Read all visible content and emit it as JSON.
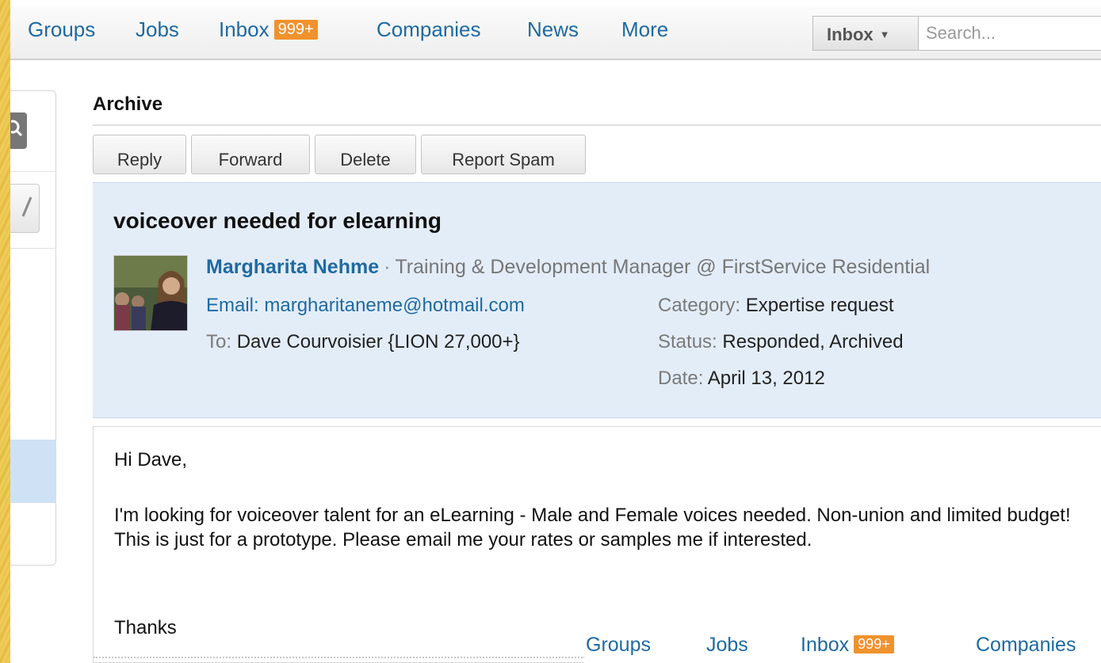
{
  "topnav": {
    "items": [
      "Groups",
      "Jobs",
      "Inbox",
      "Companies",
      "News",
      "More"
    ],
    "inbox_badge": "999+",
    "search_scope": "Inbox",
    "search_placeholder": "Search..."
  },
  "archive": {
    "title": "Archive",
    "buttons": [
      "Reply",
      "Forward",
      "Delete",
      "Report Spam"
    ]
  },
  "message": {
    "subject": "voiceover needed for elearning",
    "sender_name": "Margharita Nehme",
    "sender_title": "Training & Development Manager @ FirstService Residential",
    "email_label": "Email:",
    "email": "margharitaneme@hotmail.com",
    "to_label": "To:",
    "to": "Dave Courvoisier {LION 27,000+}",
    "category_label": "Category:",
    "category": "Expertise request",
    "status_label": "Status:",
    "status": "Responded, Archived",
    "date_label": "Date:",
    "date": "April 13, 2012",
    "body": {
      "greeting": "Hi Dave,",
      "paragraph": "I'm looking for voiceover talent for an eLearning - Male and Female voices needed. Non-union and limited budget! This is just for a prototype. Please email me your rates or samples me if interested.",
      "signoff": "Thanks"
    }
  },
  "footnav": {
    "items": [
      "Groups",
      "Jobs",
      "Inbox",
      "Companies"
    ],
    "inbox_badge": "999+"
  },
  "colors": {
    "link": "#1f6aa1",
    "badge": "#f0922d",
    "header_bg": "#e3edf8",
    "slide_bg": "#e8c24a"
  },
  "icons": {
    "sidebar_search": "search-icon",
    "sidebar_compose": "compose-icon",
    "scope_dropdown": "caret-down-icon"
  }
}
